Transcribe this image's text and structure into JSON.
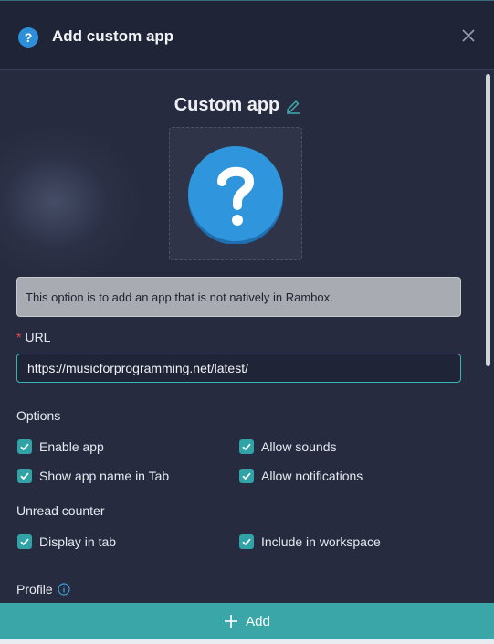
{
  "header": {
    "title": "Add custom app",
    "icon": "help-circle-icon",
    "close_icon": "close-icon"
  },
  "app": {
    "name": "Custom app",
    "edit_icon": "pencil-icon",
    "logo_icon": "question-mark-icon"
  },
  "info_text": "This option is to add an app that is not natively in Rambox.",
  "url": {
    "label": "URL",
    "required_mark": "*",
    "value": "https://musicforprogramming.net/latest/"
  },
  "options": {
    "label": "Options",
    "items": [
      {
        "label": "Enable app",
        "checked": true
      },
      {
        "label": "Allow sounds",
        "checked": true
      },
      {
        "label": "Show app name in Tab",
        "checked": true
      },
      {
        "label": "Allow notifications",
        "checked": true
      }
    ]
  },
  "unread_counter": {
    "label": "Unread counter",
    "items": [
      {
        "label": "Display in tab",
        "checked": true
      },
      {
        "label": "Include in workspace",
        "checked": true
      }
    ]
  },
  "profile": {
    "label": "Profile",
    "icon": "info-icon"
  },
  "footer": {
    "add_label": "Add",
    "add_icon": "plus-icon"
  },
  "colors": {
    "accent": "#3ba6a8",
    "background": "#262b3f",
    "header": "#1f2436",
    "logo_blue": "#2d8fd9"
  }
}
